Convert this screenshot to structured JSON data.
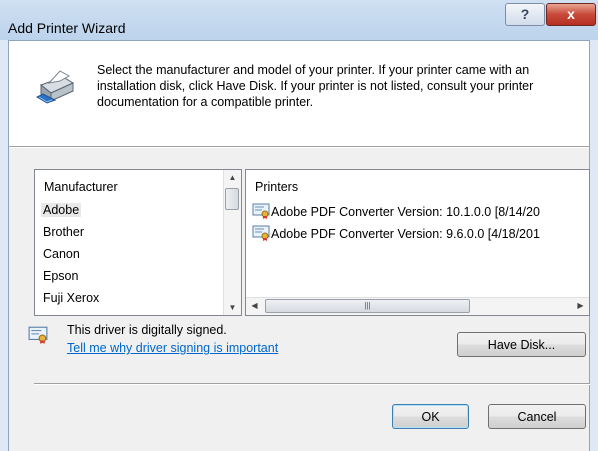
{
  "window": {
    "title": "Add Printer Wizard",
    "help_label": "?",
    "close_label": "x"
  },
  "header": {
    "instructions": "Select the manufacturer and model of your printer. If your printer came with an installation disk, click Have Disk. If your printer is not listed, consult your printer documentation for a compatible printer."
  },
  "manufacturer_list": {
    "header": "Manufacturer",
    "selected": "Adobe",
    "items": [
      "Adobe",
      "Brother",
      "Canon",
      "Epson",
      "Fuji Xerox"
    ]
  },
  "printers_list": {
    "header": "Printers",
    "items": [
      "Adobe PDF Converter Version: 10.1.0.0 [8/14/20",
      "Adobe PDF Converter Version: 9.6.0.0 [4/18/201"
    ]
  },
  "driver": {
    "signed_text": "This driver is digitally signed.",
    "link_text": "Tell me why driver signing is important"
  },
  "buttons": {
    "have_disk": "Have Disk...",
    "ok": "OK",
    "cancel": "Cancel"
  },
  "icons": {
    "printer": "printer-icon",
    "certificate": "certificate-icon"
  },
  "colors": {
    "title_bar": "#bcd3ec",
    "close_button": "#c8493a",
    "link": "#0066cc",
    "dialog_background": "#f0f0f0"
  }
}
